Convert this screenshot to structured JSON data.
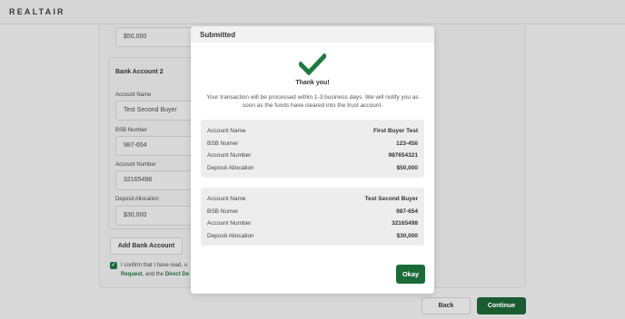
{
  "app": {
    "logo": "REALTAIR"
  },
  "form": {
    "prev_amount": "$50,000",
    "bank2_title": "Bank Account 2",
    "account_name_label": "Account Name",
    "account_name_value": "Test Second Buyer",
    "bsb_label": "BSB Number",
    "bsb_value": "987-654",
    "account_number_label": "Account Number",
    "account_number_value": "32165498",
    "deposit_label": "Deposit Allocation",
    "deposit_value": "$30,000",
    "add_bank_label": "Add Bank Account",
    "confirm_text_1": "I confirm that I have read, u",
    "confirm_link_1": "Request",
    "confirm_text_2": ", and the ",
    "confirm_link_2": "Direct De",
    "checked": true
  },
  "footer": {
    "back_label": "Back",
    "continue_label": "Continue"
  },
  "modal": {
    "title": "Submitted",
    "icon": "check-icon",
    "thank_you": "Thank you!",
    "message": "Your transaction will be processed within 1-3 business days. We will notify you as soon as the funds have cleared into the trust account.",
    "accounts": [
      {
        "rows": [
          {
            "label": "Account Name",
            "value": "First Buyer Test"
          },
          {
            "label": "BSB Numer",
            "value": "123-456"
          },
          {
            "label": "Account Number",
            "value": "987654321"
          },
          {
            "label": "Deposit Allocation",
            "value": "$50,000"
          }
        ]
      },
      {
        "rows": [
          {
            "label": "Account Name",
            "value": "Test Second Buyer"
          },
          {
            "label": "BSB Numer",
            "value": "987-654"
          },
          {
            "label": "Account Number",
            "value": "32165498"
          },
          {
            "label": "Deposit Allocation",
            "value": "$30,000"
          }
        ]
      }
    ],
    "okay_label": "Okay"
  },
  "colors": {
    "brand_green": "#1a6b37",
    "check_green": "#1f7a3f"
  }
}
